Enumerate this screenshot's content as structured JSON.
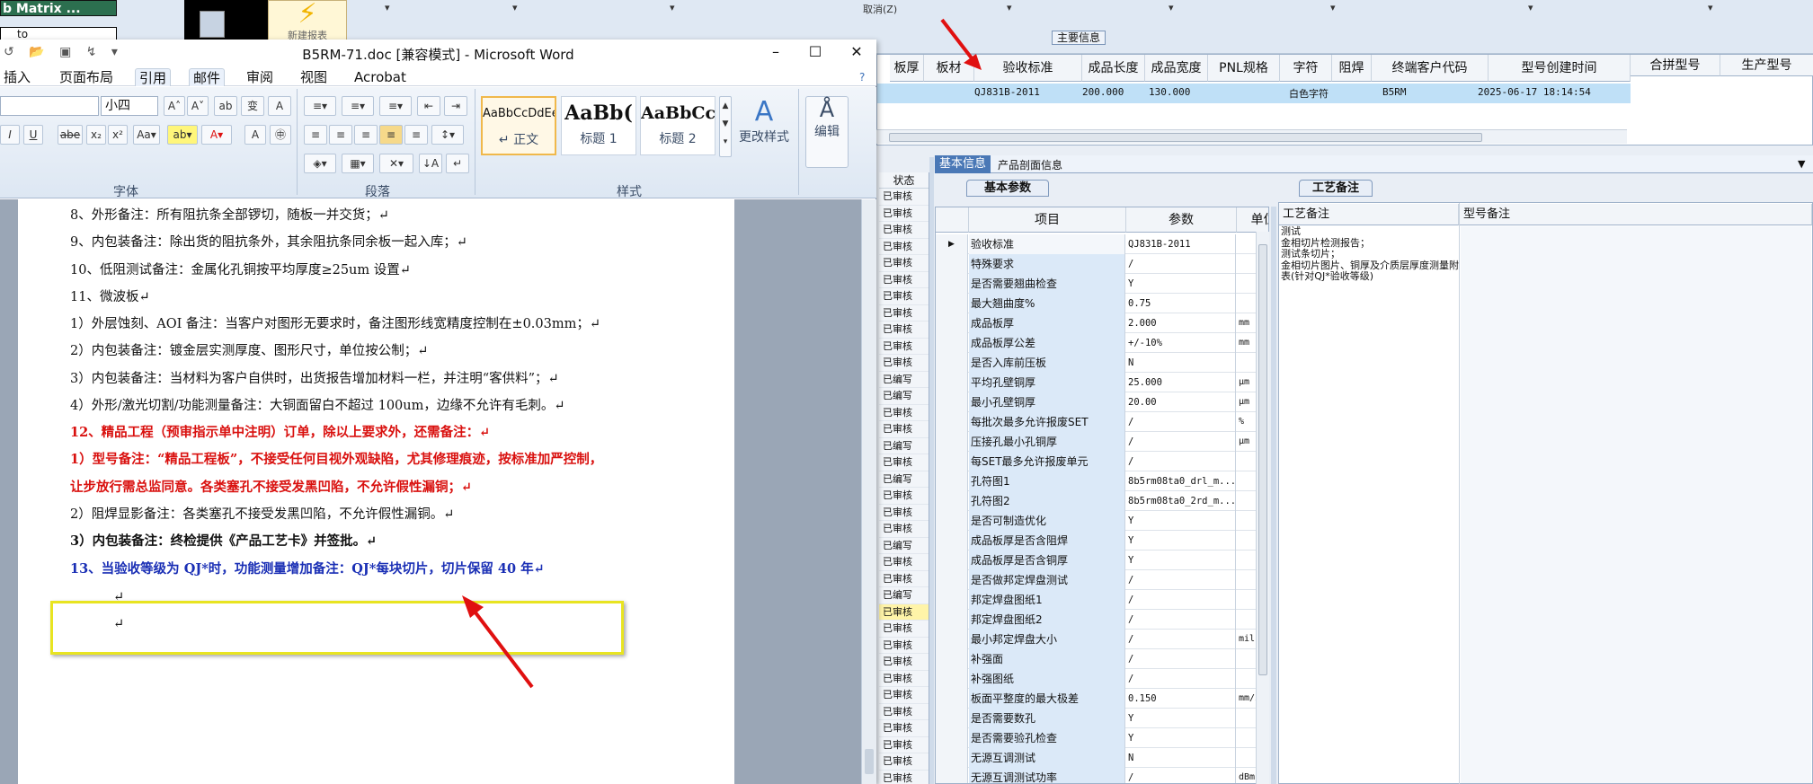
{
  "bg_app": {
    "title_fragment": "b Matrix ...",
    "title_field": "to",
    "lightning_label": "新建报表",
    "menu_items": [
      "取消(Z)"
    ],
    "main_info_label": "主要信息",
    "header_cols": [
      "板厚",
      "板材",
      "验收标准",
      "成品长度",
      "成品宽度",
      "PNL规格",
      "字符",
      "阻焊",
      "终端客户代码",
      "型号创建时间",
      "合拼型号",
      "生产型号"
    ],
    "header_row": {
      "std": "QJ831B-2011",
      "len": "200.000",
      "wid": "130.000",
      "char": "白色字符",
      "cust": "B5RM",
      "time": "2025-06-17 18:14:54"
    },
    "status_header": "状态",
    "status_items": [
      "已审核",
      "已审核",
      "已审核",
      "已审核",
      "已审核",
      "已审核",
      "已审核",
      "已审核",
      "已审核",
      "已审核",
      "已审核",
      "已编写",
      "已编写",
      "已审核",
      "已审核",
      "已编写",
      "已审核",
      "已编写",
      "已审核",
      "已审核",
      "已审核",
      "已编写",
      "已审核",
      "已审核",
      "已编写",
      "已审核",
      "已审核",
      "已审核",
      "已审核",
      "已审核",
      "已审核",
      "已审核",
      "已审核",
      "已审核",
      "已审核",
      "已审核"
    ],
    "tabs": {
      "basic": "基本信息",
      "profile": "产品剖面信息"
    },
    "subtab_params": "基本参数",
    "subtab_process": "工艺备注",
    "param_headers": [
      "项目",
      "参数",
      "单位"
    ],
    "params": [
      {
        "name": "验收标准",
        "value": "QJ831B-2011",
        "unit": ""
      },
      {
        "name": "特殊要求",
        "value": "/",
        "unit": ""
      },
      {
        "name": "是否需要翘曲检查",
        "value": "Y",
        "unit": ""
      },
      {
        "name": "最大翘曲度%",
        "value": "0.75",
        "unit": ""
      },
      {
        "name": "成品板厚",
        "value": "2.000",
        "unit": "mm"
      },
      {
        "name": "成品板厚公差",
        "value": "+/-10%",
        "unit": "mm"
      },
      {
        "name": "是否入库前压板",
        "value": "N",
        "unit": ""
      },
      {
        "name": "平均孔壁铜厚",
        "value": "25.000",
        "unit": "μm"
      },
      {
        "name": "最小孔壁铜厚",
        "value": "20.00",
        "unit": "μm"
      },
      {
        "name": "每批次最多允许报废SET",
        "value": "/",
        "unit": "%"
      },
      {
        "name": "压接孔最小孔铜厚",
        "value": "/",
        "unit": "μm"
      },
      {
        "name": "每SET最多允许报废单元",
        "value": "/",
        "unit": ""
      },
      {
        "name": "孔符图1",
        "value": "8b5rm08ta0_drl_m...",
        "unit": ""
      },
      {
        "name": "孔符图2",
        "value": "8b5rm08ta0_2rd_m...",
        "unit": ""
      },
      {
        "name": "是否可制造优化",
        "value": "Y",
        "unit": ""
      },
      {
        "name": "成品板厚是否含阻焊",
        "value": "Y",
        "unit": ""
      },
      {
        "name": "成品板厚是否含铜厚",
        "value": "Y",
        "unit": ""
      },
      {
        "name": "是否做邦定焊盘测试",
        "value": "/",
        "unit": ""
      },
      {
        "name": "邦定焊盘图纸1",
        "value": "/",
        "unit": ""
      },
      {
        "name": "邦定焊盘图纸2",
        "value": "/",
        "unit": ""
      },
      {
        "name": "最小邦定焊盘大小",
        "value": "/",
        "unit": "mil"
      },
      {
        "name": "补强面",
        "value": "/",
        "unit": ""
      },
      {
        "name": "补强图纸",
        "value": "/",
        "unit": ""
      },
      {
        "name": "板面平整度的最大极差",
        "value": "0.150",
        "unit": "mm/inch"
      },
      {
        "name": "是否需要数孔",
        "value": "Y",
        "unit": ""
      },
      {
        "name": "是否需要验孔检查",
        "value": "Y",
        "unit": ""
      },
      {
        "name": "无源互调测试",
        "value": "N",
        "unit": ""
      },
      {
        "name": "无源互调测试功率",
        "value": "/",
        "unit": "dBm"
      }
    ],
    "process_header": "工艺备注",
    "model_header": "型号备注",
    "process_note": "测试\n金相切片检测报告；\n测试条切片；\n金相切片图片、铜厚及介质层厚度测量附表(针对QJ*验收等级)"
  },
  "word": {
    "title": "B5RM-71.doc [兼容模式] - Microsoft Word",
    "menus": [
      "插入",
      "页面布局",
      "引用",
      "邮件",
      "审阅",
      "视图",
      "Acrobat"
    ],
    "font_size": "小四",
    "styles": [
      {
        "preview": "AaBbCcDdEe",
        "label": "↵ 正文"
      },
      {
        "preview": "AaBb(",
        "label": "标题 1"
      },
      {
        "preview": "AaBbCc",
        "label": "标题 2"
      }
    ],
    "change_styles": "更改样式",
    "edit": "编辑",
    "groups": {
      "font": "字体",
      "para": "段落",
      "style": "样式"
    },
    "doc_lines": [
      {
        "text": "8、外形备注：所有阻抗条全部锣切，随板一并交货；↵",
        "cls": ""
      },
      {
        "text": "9、内包装备注：除出货的阻抗条外，其余阻抗条同余板一起入库；↵",
        "cls": ""
      },
      {
        "text": "10、低阻测试备注：金属化孔铜按平均厚度≥25um 设置↵",
        "cls": ""
      },
      {
        "text": "11、微波板↵",
        "cls": ""
      },
      {
        "text": "1）外层蚀刻、AOI 备注：当客户对图形无要求时，备注图形线宽精度控制在±0.03mm；↵",
        "cls": ""
      },
      {
        "text": "2）内包装备注：镀金层实测厚度、图形尺寸，单位按公制；↵",
        "cls": ""
      },
      {
        "text": "3）内包装备注：当材料为客户自供时，出货报告增加材料一栏，并注明“客供料”；↵",
        "cls": ""
      },
      {
        "text": "4）外形/激光切割/功能测量备注：大铜面留白不超过 100um，边缘不允许有毛刺。↵",
        "cls": ""
      },
      {
        "text": "12、精品工程（预审指示单中注明）订单，除以上要求外，还需备注：↵",
        "cls": "red"
      },
      {
        "text": "1）型号备注：“精品工程板”，不接受任何目视外观缺陷，尤其修理痕迹，按标准加严控制，",
        "cls": "red"
      },
      {
        "text": "让步放行需总监同意。各类塞孔不接受发黑凹陷，不允许假性漏铜；↵",
        "cls": "red"
      },
      {
        "text": "2）阻焊显影备注：各类塞孔不接受发黑凹陷，不允许假性漏铜。↵",
        "cls": ""
      },
      {
        "text": "3）内包装备注：终检提供《产品工艺卡》并签批。↵",
        "cls": "bold"
      },
      {
        "text": "13、当验收等级为 QJ*时，功能测量增加备注：QJ*每块切片，切片保留 40 年↵",
        "cls": "blue"
      },
      {
        "text": "↵",
        "cls": ""
      },
      {
        "text": "↵",
        "cls": ""
      }
    ]
  }
}
